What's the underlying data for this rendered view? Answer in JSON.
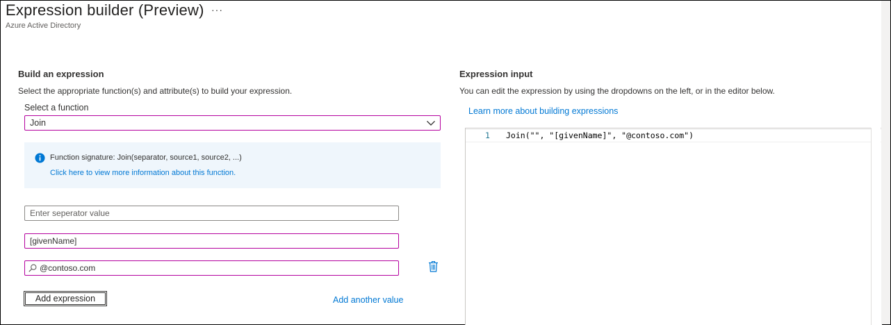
{
  "header": {
    "title": "Expression builder (Preview)",
    "more_icon": "···",
    "subtitle": "Azure Active Directory"
  },
  "left": {
    "section_title": "Build an expression",
    "description": "Select the appropriate function(s) and attribute(s) to build your expression.",
    "function_label": "Select a function",
    "function_selected": "Join",
    "info": {
      "signature": "Function signature: Join(separator, source1, source2, ...)",
      "link": "Click here to view more information about this function."
    },
    "separator_input": {
      "value": "",
      "placeholder": "Enter seperator value"
    },
    "source1_input": {
      "value": "[givenName]"
    },
    "source2_input": {
      "value": "@contoso.com"
    },
    "add_expression_button": "Add expression",
    "add_another_link": "Add another value"
  },
  "right": {
    "section_title": "Expression input",
    "description": "You can edit the expression by using the dropdowns on the left, or in the editor below.",
    "learn_more_link": "Learn more about building expressions",
    "editor": {
      "line_number": "1",
      "code": "Join(\"\", \"[givenName]\", \"@contoso.com\")"
    }
  },
  "colors": {
    "accent_link": "#0078d4",
    "active_border": "#b4009e",
    "info_background": "#eff6fc"
  },
  "icons": [
    "more-icon",
    "chevron-down-icon",
    "info-icon",
    "search-icon",
    "trash-icon"
  ]
}
